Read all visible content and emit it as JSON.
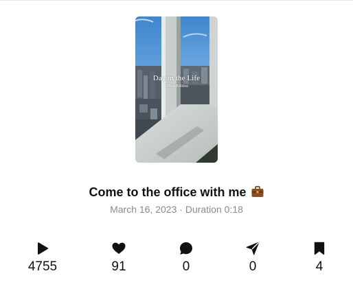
{
  "video": {
    "overlay_title": "Day in the Life",
    "overlay_subtitle": "Office Edition"
  },
  "post": {
    "title": "Come to the office with me",
    "title_emoji": "briefcase-emoji",
    "date": "March 16, 2023",
    "separator": "·",
    "duration_label": "Duration 0:18"
  },
  "stats": [
    {
      "icon": "play-icon",
      "value": "4755"
    },
    {
      "icon": "heart-icon",
      "value": "91"
    },
    {
      "icon": "comment-icon",
      "value": "0"
    },
    {
      "icon": "send-icon",
      "value": "0"
    },
    {
      "icon": "bookmark-icon",
      "value": "4"
    }
  ],
  "colors": {
    "text": "#111111",
    "meta_text": "#8a8a8a",
    "icon": "#111111"
  }
}
